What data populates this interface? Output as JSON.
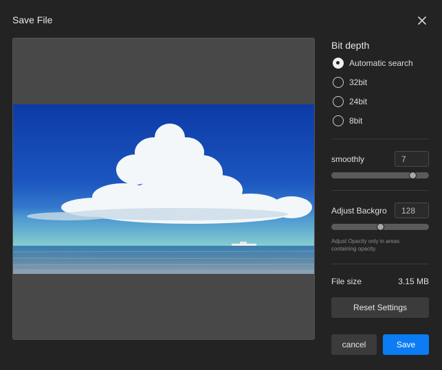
{
  "dialog": {
    "title": "Save File"
  },
  "bit_depth": {
    "title": "Bit depth",
    "options": [
      {
        "label": "Automatic search",
        "selected": true
      },
      {
        "label": "32bit",
        "selected": false
      },
      {
        "label": "24bit",
        "selected": false
      },
      {
        "label": "8bit",
        "selected": false
      }
    ]
  },
  "smoothly": {
    "label": "smoothly",
    "value": "7",
    "level": 0.86
  },
  "background": {
    "label": "Adjust Backgro",
    "value": "128",
    "level": 0.5,
    "hint": "Adjust Opacity only in areas containing opacity."
  },
  "file_size": {
    "label": "File size",
    "value": "3.15 MB"
  },
  "buttons": {
    "reset": "Reset Settings",
    "cancel": "cancel",
    "save": "Save"
  },
  "colors": {
    "accent": "#0b7cf3",
    "background": "#232323",
    "preview_bg": "#484848"
  },
  "icons": {
    "close": "close-icon"
  }
}
